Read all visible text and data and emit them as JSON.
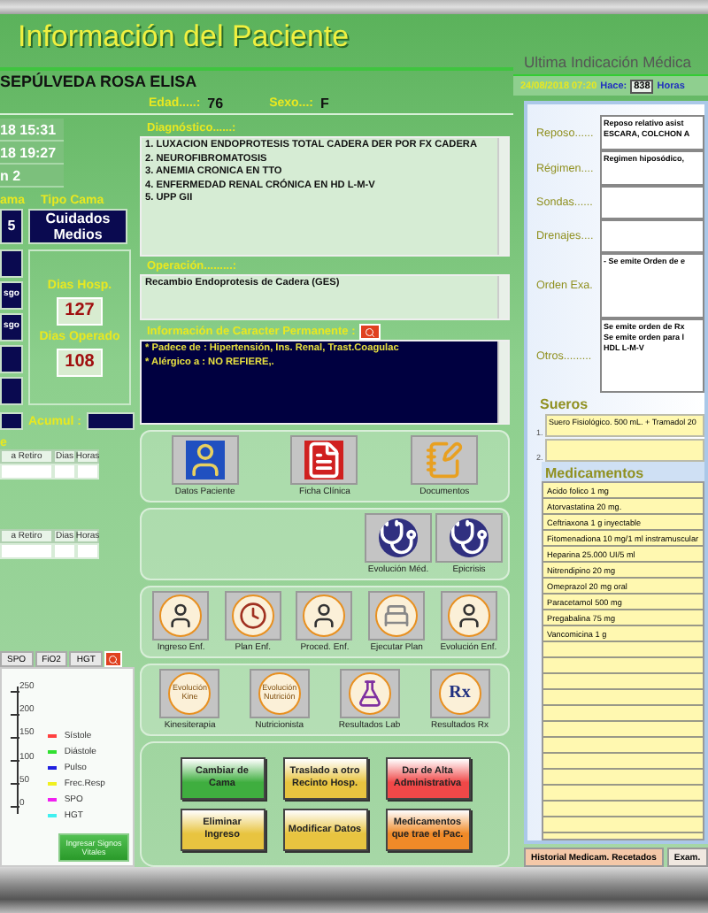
{
  "header": {
    "title": "Información del Paciente"
  },
  "patient": {
    "name": "SEPÚLVEDA ROSA ELISA",
    "age_label": "Edad.....:",
    "age": "76",
    "sex_label": "Sexo...:",
    "sex": "F"
  },
  "admission": {
    "dates": [
      "18 15:31",
      "18 19:27",
      "n 2"
    ],
    "bed_label": "ama",
    "bed": "5",
    "bed_type_label": "Tipo Cama",
    "bed_type": "Cuidados Medios",
    "side_fields": [
      {
        "kind": "blank"
      },
      {
        "kind": "text",
        "value": "sgo"
      },
      {
        "kind": "text",
        "value": "sgo"
      },
      {
        "kind": "blank"
      },
      {
        "kind": "blank"
      }
    ],
    "days_hosp_label": "Dias Hosp.",
    "days_hosp": "127",
    "days_op_label": "Dias Operado",
    "days_op": "108",
    "accum_label": "Acumul :"
  },
  "diagnosis": {
    "label": "Diagnóstico......:",
    "lines": [
      "1. LUXACION ENDOPROTESIS TOTAL CADERA DER POR FX CADERA",
      "2. NEUROFIBROMATOSIS",
      "3. ANEMIA CRONICA EN TTO",
      "4. ENFERMEDAD RENAL CRÓNICA EN HD L-M-V",
      "5. UPP GII"
    ]
  },
  "operation": {
    "label": "Operación.........:",
    "text": "Recambio Endoprotesis de Cadera (GES)"
  },
  "permanent_info": {
    "label": "Información de Caracter Permanente :",
    "lines": [
      "* Padece de : Hipertensión, Ins. Renal, Trast.Coagulac",
      "* Alérgico a : NO REFIERE,."
    ]
  },
  "device_tables": [
    {
      "title": "e",
      "columns": [
        "a Retiro",
        "Dias",
        "Horas"
      ]
    },
    {
      "columns": [
        "a Retiro",
        "Dias",
        "Horas"
      ]
    }
  ],
  "vitals": {
    "tabs": [
      "SPO",
      "FiO2",
      "HGT"
    ],
    "axis_ticks": [
      "250",
      "200",
      "150",
      "100",
      "50",
      "0"
    ],
    "legend": [
      {
        "label": "Sístole",
        "color": "#ff4040"
      },
      {
        "label": "Diástole",
        "color": "#30e030"
      },
      {
        "label": "Pulso",
        "color": "#2020e0"
      },
      {
        "label": "Frec.Resp",
        "color": "#f0f020"
      },
      {
        "label": "SPO",
        "color": "#f020f0"
      },
      {
        "label": "HGT",
        "color": "#40f0f0"
      }
    ],
    "button": "Ingresar Signos Vitales"
  },
  "tile_groups": [
    [
      {
        "label": "Datos Paciente"
      },
      {
        "label": "Ficha Clínica"
      },
      {
        "label": "Documentos"
      }
    ],
    [
      {
        "label": "Evolución Méd."
      },
      {
        "label": "Epicrisis"
      }
    ],
    [
      {
        "label": "Ingreso Enf."
      },
      {
        "label": "Plan Enf."
      },
      {
        "label": "Proced. Enf."
      },
      {
        "label": "Ejecutar Plan"
      },
      {
        "label": "Evolución Enf."
      }
    ],
    [
      {
        "label": "Kinesiterapia",
        "caption": "Evolución Kine"
      },
      {
        "label": "Nutricionista",
        "caption": "Evolución Nutrición"
      },
      {
        "label": "Resultados Lab"
      },
      {
        "label": "Resultados Rx",
        "caption": "Rx"
      }
    ]
  ],
  "commands": [
    {
      "label": "Cambiar de Cama",
      "color": "#3fae3f"
    },
    {
      "label": "Traslado a otro Recinto Hosp.",
      "color": "#e8c440"
    },
    {
      "label": "Dar de Alta Administrativa",
      "color": "#f04848"
    },
    {
      "label": "Eliminar Ingreso",
      "color": "#e8c440"
    },
    {
      "label": "Modificar Datos",
      "color": "#e8c440"
    },
    {
      "label": "Medicamentos que trae el Pac.",
      "color": "#f08a28"
    }
  ],
  "indication": {
    "title": "Ultima Indicación Médica",
    "date": "24/08/2018 07:20",
    "ago_label": "Hace:",
    "hours": "838",
    "hours_label": "Horas",
    "fields": [
      {
        "label": "Reposo......",
        "lines": [
          "Reposo relativo asist",
          "ESCARA, COLCHON A"
        ]
      },
      {
        "label": "Régimen....",
        "lines": [
          "Regimen hiposódico,"
        ]
      },
      {
        "label": "Sondas......"
      },
      {
        "label": "Drenajes...."
      },
      {
        "label": "Orden Exa.",
        "lines": [
          "- Se emite Orden de e"
        ]
      },
      {
        "label": "Otros.........",
        "lines": [
          "Se emite orden de Rx",
          "Se emite orden para l",
          "HDL L-M-V"
        ]
      }
    ],
    "fluids_title": "Sueros",
    "fluids": [
      {
        "number": "1.",
        "text": "Suero Fisiológico. 500 mL. + Tramadol 20"
      },
      {
        "number": "2."
      }
    ],
    "meds_title": "Medicamentos",
    "meds": [
      "Acido folico 1 mg",
      "Atorvastatina 20 mg.",
      "Ceftriaxona 1 g inyectable",
      "Fitomenadiona 10 mg/1 ml instramuscular",
      "Heparina 25.000 UI/5 ml",
      "Nitrendipino 20 mg",
      "Omeprazol 20 mg oral",
      "Paracetamol 500 mg",
      "Pregabalina 75 mg",
      "Vancomicina 1 g"
    ],
    "tabs": [
      {
        "label": "Historial Medicam. Recetados",
        "selected": true
      },
      {
        "label": "Exam.",
        "selected": false
      }
    ]
  }
}
